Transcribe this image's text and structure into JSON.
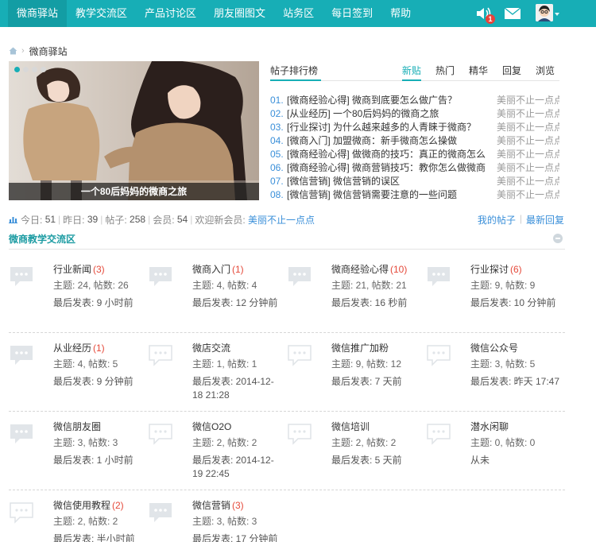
{
  "nav": {
    "items": [
      "微商驿站",
      "教学交流区",
      "产品讨论区",
      "朋友圈图文",
      "站务区",
      "每日签到",
      "帮助"
    ],
    "notification_count": "1"
  },
  "breadcrumb": {
    "current": "微商驿站"
  },
  "banner": {
    "caption": "一个80后妈妈的微商之旅"
  },
  "ranking": {
    "title": "帖子排行榜",
    "tabs": [
      "新贴",
      "热门",
      "精华",
      "回复",
      "浏览"
    ],
    "rows": [
      {
        "num": "01.",
        "text": "[微商经验心得] 微商到底要怎么做广告？",
        "user": "美丽不止一点点"
      },
      {
        "num": "02.",
        "text": "[从业经历] 一个80后妈妈的微商之旅",
        "user": "美丽不止一点点"
      },
      {
        "num": "03.",
        "text": "[行业探讨] 为什么越来越多的人青睐于微商？",
        "user": "美丽不止一点点"
      },
      {
        "num": "04.",
        "text": "[微商入门] 加盟微商：新手微商怎么操做",
        "user": "美丽不止一点点"
      },
      {
        "num": "05.",
        "text": "[微商经验心得] 做微商的技巧：真正的微商怎么",
        "user": "美丽不止一点点"
      },
      {
        "num": "06.",
        "text": "[微商经验心得] 微商营销技巧：教你怎么做微商",
        "user": "美丽不止一点点"
      },
      {
        "num": "07.",
        "text": "[微信营销] 微信营销的误区",
        "user": "美丽不止一点点"
      },
      {
        "num": "08.",
        "text": "[微信营销] 微信营销需要注意的一些问题",
        "user": "美丽不止一点点"
      }
    ]
  },
  "stats": {
    "today_label": "今日:",
    "today": "51",
    "yesterday_label": "昨日:",
    "yesterday": "39",
    "posts_label": "帖子:",
    "posts": "258",
    "members_label": "会员:",
    "members": "54",
    "welcome_label": "欢迎新会员:",
    "new_member": "美丽不止一点点",
    "my_posts": "我的帖子",
    "latest_replies": "最新回复"
  },
  "section": {
    "title": "微商教学交流区",
    "rows": [
      [
        {
          "name": "行业新闻",
          "count": "(3)",
          "meta": "主题: 24, 帖数: 26",
          "last": "最后发表: 9 小时前"
        },
        {
          "name": "微商入门",
          "count": "(1)",
          "meta": "主题: 4, 帖数: 4",
          "last": "最后发表: 12 分钟前"
        },
        {
          "name": "微商经验心得",
          "count": "(10)",
          "meta": "主题: 21, 帖数: 21",
          "last": "最后发表: 16 秒前"
        },
        {
          "name": "行业探讨",
          "count": "(6)",
          "meta": "主题: 9, 帖数: 9",
          "last": "最后发表: 10 分钟前"
        }
      ],
      [
        {
          "name": "从业经历",
          "count": "(1)",
          "meta": "主题: 4, 帖数: 5",
          "last": "最后发表: 9 分钟前"
        },
        {
          "name": "微店交流",
          "count": "",
          "meta": "主题: 1, 帖数: 1",
          "last": "最后发表: 2014-12-18 21:28"
        },
        {
          "name": "微信推广加粉",
          "count": "",
          "meta": "主题: 9, 帖数: 12",
          "last": "最后发表: 7 天前"
        },
        {
          "name": "微信公众号",
          "count": "",
          "meta": "主题: 3, 帖数: 5",
          "last": "最后发表: 昨天 17:47"
        }
      ],
      [
        {
          "name": "微信朋友圈",
          "count": "",
          "meta": "主题: 3, 帖数: 3",
          "last": "最后发表: 1 小时前"
        },
        {
          "name": "微信O2O",
          "count": "",
          "meta": "主题: 2, 帖数: 2",
          "last": "最后发表: 2014-12-19 22:45"
        },
        {
          "name": "微信培训",
          "count": "",
          "meta": "主题: 2, 帖数: 2",
          "last": "最后发表: 5 天前"
        },
        {
          "name": "潜水闲聊",
          "count": "",
          "meta": "主题: 0, 帖数: 0",
          "last": "从未"
        }
      ],
      [
        {
          "name": "微信使用教程",
          "count": "(2)",
          "meta": "主题: 2, 帖数: 2",
          "last": "最后发表: 半小时前"
        },
        {
          "name": "微信营销",
          "count": "(3)",
          "meta": "主题: 3, 帖数: 3",
          "last": "最后发表: 17 分钟前"
        }
      ]
    ]
  },
  "colors": {
    "brand": "#17aeb6",
    "link": "#3a8fd9",
    "count": "#e5493a"
  },
  "icons": [
    "volume-icon",
    "mail-icon",
    "avatar",
    "home-icon",
    "chart-icon",
    "forum-bubble-icon"
  ]
}
